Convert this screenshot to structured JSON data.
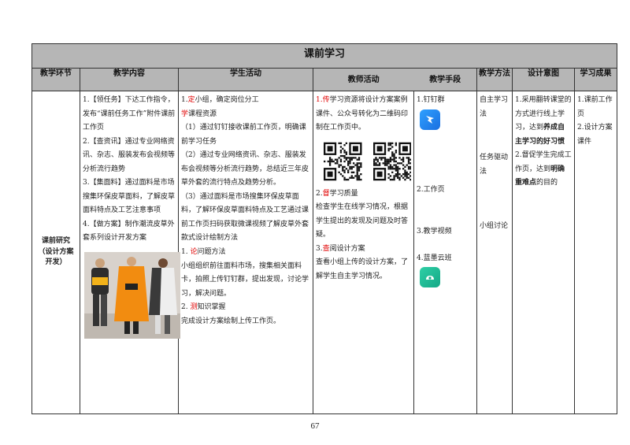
{
  "title": "课前学习",
  "headers": [
    "教学环节",
    "教学内容",
    "学生活动",
    "教师活动",
    "教学手段",
    "教学方法",
    "设计意图",
    "学习成果"
  ],
  "stage": "课前研究（设计方案开发）",
  "content": [
    "1.【领任务】下达工作指令，发布“课前任务工作”附件课前工作页",
    "2.【查资讯】通过专业网络资讯、杂志、服装发布会视频等分析流行趋势",
    "3.【集面料】通过面料是市场搜集环保皮草面料，了解皮草面料特点及工艺注意事项",
    "4.【做方案】制作潮流皮草外套系列设计开发方案"
  ],
  "student": {
    "s1_num": "1.",
    "s1_red": "定",
    "s1_rest": "小组，确定岗位分工",
    "s2_red": "学",
    "s2_rest": "课程资源",
    "p1": "（1）通过钉钉接收课前工作页，明确课前学习任务",
    "p2": "（2）通过专业网络资讯、杂志、服装发布会视频等分析流行趋势，总结近三年皮草外套的流行特点及趋势分析。",
    "p3": "（3）通过面料是市场搜集环保皮草面料，了解环保皮草面料特点及工艺通过课前工作页扫码获取微课视频了解皮草外套款式设计绘制方法",
    "s3_num": "1.",
    "s3_red": "论",
    "s3_rest": "问题方法",
    "p4": "小组组织前往面料市场，搜集相关面料卡，拍照上传钉钉群，提出发现，讨论学习，解决问题。",
    "s4_num": "2.",
    "s4_red": "测",
    "s4_rest": "知识掌握",
    "p5": "完成设计方案绘制上传工作页。"
  },
  "teacher": {
    "t1_num": "1.",
    "t1_red": "传",
    "t1_rest": "学习资源将设计方案案例课件、公众号转化为二维码印制在工作页中。",
    "t2_num": "2.",
    "t2_red": "督",
    "t2_rest": "学习质量",
    "t2_text": "检查学生在线学习情况，根据学生提出的发现及问题及时答疑。",
    "t3_num": "3.",
    "t3_red": "查",
    "t3_rest": "阅设计方案",
    "t3_text": "查看小组上传的设计方案，了解学生自主学习情况。"
  },
  "means": [
    "1.钉钉群",
    "2.工作页",
    "3.教学视频",
    "4.蓝墨云班"
  ],
  "method": [
    "自主学习法",
    "任务驱动法",
    "小组讨论"
  ],
  "intent": {
    "i1a": "1.采用翻转课堂的方式进行线上学习，达到",
    "i1b": "养成自主学习的好习惯",
    "i2a": "2.督促学生完成工作页，达到",
    "i2b": "明确重难点",
    "i2c": "的目的"
  },
  "outcome": [
    "1.课前工作页",
    "2.设计方案课件"
  ],
  "page_number": "67",
  "colors": {
    "header_bg": "#b6b6b6",
    "emphasis_red": "#e00000",
    "dingtalk": "#1a6fe0",
    "lanmo": "#14a886"
  },
  "icons": [
    "qr-code-icon",
    "dingtalk-app-icon",
    "lanmo-cloud-app-icon"
  ]
}
